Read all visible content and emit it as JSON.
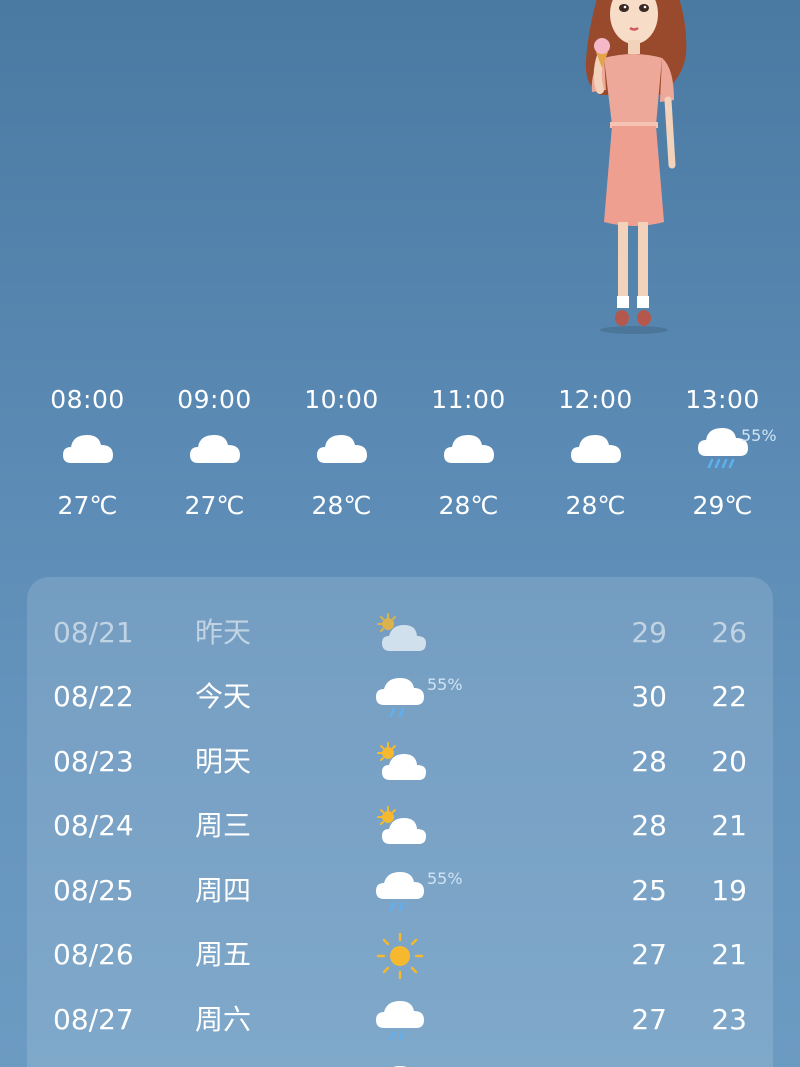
{
  "hourly": [
    {
      "time": "08:00",
      "icon": "cloudy-icon",
      "temp": "27℃",
      "precip": ""
    },
    {
      "time": "09:00",
      "icon": "cloudy-icon",
      "temp": "27℃",
      "precip": ""
    },
    {
      "time": "10:00",
      "icon": "cloudy-icon",
      "temp": "28℃",
      "precip": ""
    },
    {
      "time": "11:00",
      "icon": "cloudy-icon",
      "temp": "28℃",
      "precip": ""
    },
    {
      "time": "12:00",
      "icon": "cloudy-icon",
      "temp": "28℃",
      "precip": ""
    },
    {
      "time": "13:00",
      "icon": "rain-icon",
      "temp": "29℃",
      "precip": "55%"
    }
  ],
  "daily": [
    {
      "date": "08/21",
      "day": "昨天",
      "icon": "partly-cloudy-icon",
      "precip": "",
      "high": "29",
      "low": "26"
    },
    {
      "date": "08/22",
      "day": "今天",
      "icon": "rain-icon",
      "precip": "55%",
      "high": "30",
      "low": "22"
    },
    {
      "date": "08/23",
      "day": "明天",
      "icon": "partly-cloudy-icon",
      "precip": "",
      "high": "28",
      "low": "20"
    },
    {
      "date": "08/24",
      "day": "周三",
      "icon": "partly-cloudy-icon",
      "precip": "",
      "high": "28",
      "low": "21"
    },
    {
      "date": "08/25",
      "day": "周四",
      "icon": "rain-icon",
      "precip": "55%",
      "high": "25",
      "low": "19"
    },
    {
      "date": "08/26",
      "day": "周五",
      "icon": "sunny-icon",
      "precip": "",
      "high": "27",
      "low": "21"
    },
    {
      "date": "08/27",
      "day": "周六",
      "icon": "rain-icon",
      "precip": "",
      "high": "27",
      "low": "23"
    }
  ],
  "colors": {
    "background_top": "#4a7aa2",
    "background_bottom": "#6c9bc2",
    "sun": "#f5b82e",
    "rain_drops": "#5fb0f0",
    "precip_text": "#cfe3f4"
  }
}
